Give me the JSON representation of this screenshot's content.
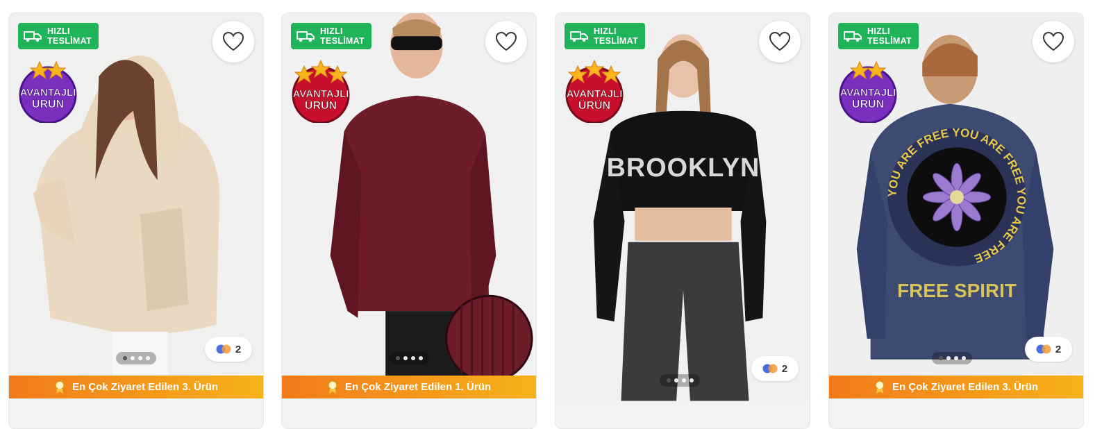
{
  "products": [
    {
      "fast_delivery": [
        "HIZLI",
        "TESLİMAT"
      ],
      "badge": {
        "line1": "AVANTAJLI",
        "line2": "ÜRÜN",
        "style": "purple"
      },
      "color_count": "2",
      "ribbon_text": "En Çok Ziyaret Edilen 3. Ürün"
    },
    {
      "fast_delivery": [
        "HIZLI",
        "TESLİMAT"
      ],
      "badge": {
        "line1": "AVANTAJLI",
        "line2": "ÜRÜN",
        "style": "red"
      },
      "color_count": "",
      "ribbon_text": "En Çok Ziyaret Edilen 1. Ürün"
    },
    {
      "fast_delivery": [
        "HIZLI",
        "TESLİMAT"
      ],
      "badge": {
        "line1": "AVANTAJLI",
        "line2": "ÜRÜN",
        "style": "red"
      },
      "color_count": "2",
      "ribbon_text": ""
    },
    {
      "fast_delivery": [
        "HIZLI",
        "TESLİMAT"
      ],
      "badge": {
        "line1": "AVANTAJLI",
        "line2": "ÜRÜN",
        "style": "purple"
      },
      "color_count": "2",
      "ribbon_text": "En Çok Ziyaret Edilen 3. Ürün"
    }
  ],
  "print_text": {
    "brooklyn": "BROOKLYN",
    "free_spirit": "FREE SPIRIT",
    "ring": "YOU ARE FREE YOU ARE FREE YOU ARE FREE"
  },
  "colors": {
    "fast_green": "#20b45a",
    "ribbon_orange": "#f27a1a",
    "ribbon_yellow": "#f5b21a",
    "badge_purple": "#7b2fbf",
    "badge_red": "#c8102e"
  },
  "icons": [
    "truck-icon",
    "heart-icon",
    "color-swatch-icon",
    "medal-icon",
    "star-icon"
  ]
}
